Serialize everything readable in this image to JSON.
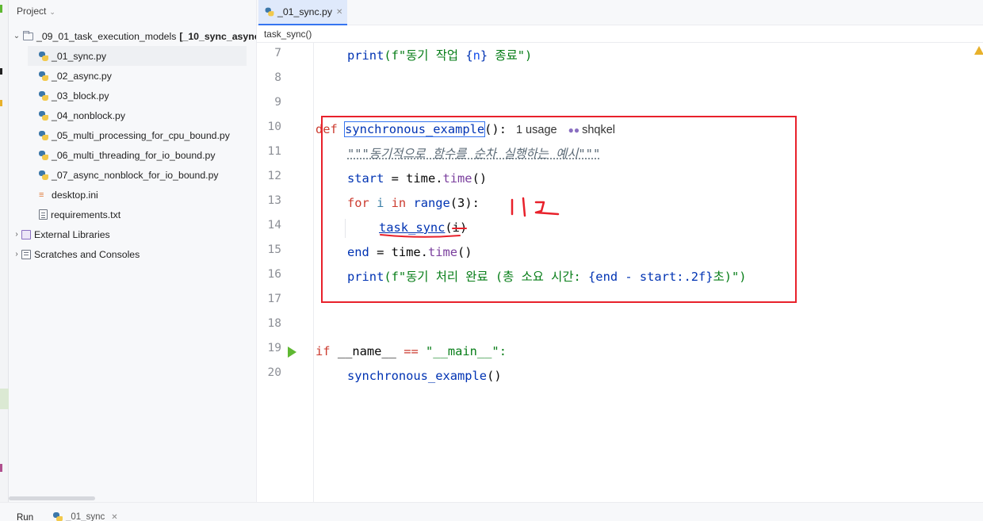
{
  "project": {
    "header": "Project",
    "root": "_09_01_task_execution_models",
    "root_module": "[_10_sync_async",
    "files": [
      {
        "name": "_01_sync.py",
        "type": "py",
        "selected": true
      },
      {
        "name": "_02_async.py",
        "type": "py"
      },
      {
        "name": "_03_block.py",
        "type": "py"
      },
      {
        "name": "_04_nonblock.py",
        "type": "py"
      },
      {
        "name": "_05_multi_processing_for_cpu_bound.py",
        "type": "py"
      },
      {
        "name": "_06_multi_threading_for_io_bound.py",
        "type": "py"
      },
      {
        "name": "_07_async_nonblock_for_io_bound.py",
        "type": "py"
      },
      {
        "name": "desktop.ini",
        "type": "ini"
      },
      {
        "name": "requirements.txt",
        "type": "txt"
      }
    ],
    "external_libraries": "External Libraries",
    "scratches": "Scratches and Consoles"
  },
  "editor": {
    "tab": "_01_sync.py",
    "breadcrumb": "task_sync()",
    "line_numbers": [
      "7",
      "8",
      "9",
      "10",
      "11",
      "12",
      "13",
      "14",
      "15",
      "16",
      "17",
      "18",
      "19",
      "20"
    ],
    "inlay_usage": "1 usage",
    "inlay_author": "shqkel",
    "code": {
      "l7_print": "print",
      "l7_fs": "(f\"동기 작업 ",
      "l7_var": "n",
      "l7_end": " 종료\")",
      "l10_def": "def",
      "l10_name": "synchronous_example",
      "l10_paren": "():",
      "l11_doc": "\"\"\"동기적으로 함수를 순차 실행하는 예시\"\"\"",
      "l12_a": "start",
      "l12_b": " = time.",
      "l12_c": "time",
      "l12_d": "()",
      "l13_for": "for",
      "l13_i": " i ",
      "l13_in": "in",
      "l13_range": " range",
      "l13_args": "(3):",
      "l14_call": "task_sync",
      "l14_args": "(i)",
      "l15_a": "end",
      "l15_b": " = time.",
      "l15_c": "time",
      "l15_d": "()",
      "l16_print": "print",
      "l16_fs": "(f\"동기 처리 완료 (총 소요 시간: ",
      "l16_expr": "{end - start:.2f}",
      "l16_end": "초)\")",
      "l19_if": "if",
      "l19_name": " __name__ ",
      "l19_eq": "==",
      "l19_str": " \"__main__\":",
      "l20_call": "synchronous_example",
      "l20_paren": "()"
    }
  },
  "run": {
    "label": "Run",
    "tab": "_01_sync"
  },
  "colors": {
    "annotation": "#e8212b",
    "run_gutter_icon": "#5fb832",
    "selection_tab_accent": "#3574f0"
  }
}
